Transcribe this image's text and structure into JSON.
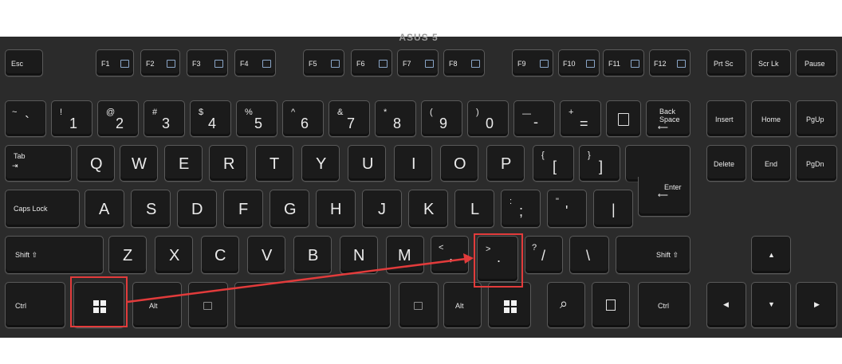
{
  "brand": "ASUS 5",
  "colors": {
    "keyboard": "#2b2b2b",
    "key": "#1b1b1b",
    "highlight": "#e23b3b",
    "fn_icon": "#8aa6c8"
  },
  "function_row": [
    "Esc",
    "F1",
    "F2",
    "F3",
    "F4",
    "F5",
    "F6",
    "F7",
    "F8",
    "F9",
    "F10",
    "F11",
    "F12",
    "Prt Sc",
    "Scr Lk",
    "Pause"
  ],
  "number_row": [
    {
      "pri": "`",
      "sec": "~"
    },
    {
      "pri": "1",
      "sec": "!"
    },
    {
      "pri": "2",
      "sec": "@"
    },
    {
      "pri": "3",
      "sec": "#"
    },
    {
      "pri": "4",
      "sec": "$"
    },
    {
      "pri": "5",
      "sec": "%"
    },
    {
      "pri": "6",
      "sec": "^"
    },
    {
      "pri": "7",
      "sec": "&"
    },
    {
      "pri": "8",
      "sec": "*"
    },
    {
      "pri": "9",
      "sec": "("
    },
    {
      "pri": "0",
      "sec": ")"
    },
    {
      "pri": "-",
      "sec": "—"
    },
    {
      "pri": "=",
      "sec": "+"
    }
  ],
  "backspace": {
    "line1": "Back",
    "line2": "Space"
  },
  "nav_keys": [
    "Insert",
    "Home",
    "PgUp",
    "Delete",
    "End",
    "PgDn"
  ],
  "tab": "Tab",
  "qwerty": [
    "Q",
    "W",
    "E",
    "R",
    "T",
    "Y",
    "U",
    "I",
    "O",
    "P"
  ],
  "brackets": [
    {
      "pri": "[",
      "sec": "{"
    },
    {
      "pri": "]",
      "sec": "}"
    }
  ],
  "caps": "Caps Lock",
  "asdf": [
    "A",
    "S",
    "D",
    "F",
    "G",
    "H",
    "J",
    "K",
    "L"
  ],
  "semi": {
    "pri": ";",
    "sec": ":"
  },
  "quote": {
    "pri": "'",
    "sec": "\""
  },
  "pipe": "|",
  "enter": "Enter",
  "shift_left": "Shift ⇧",
  "zxcv": [
    "Z",
    "X",
    "C",
    "V",
    "B",
    "N",
    "M"
  ],
  "comma": {
    "pri": ",",
    "sec": "<"
  },
  "period": {
    "pri": ".",
    "sec": ">"
  },
  "slash": {
    "pri": "/",
    "sec": "?"
  },
  "backslash": "\\",
  "shift_right": "Shift ⇧",
  "ctrl": "Ctrl",
  "alt": "Alt",
  "search_glyph": "⌕",
  "arrows": {
    "up": "▲",
    "left": "◀",
    "down": "▼",
    "right": "▶"
  }
}
